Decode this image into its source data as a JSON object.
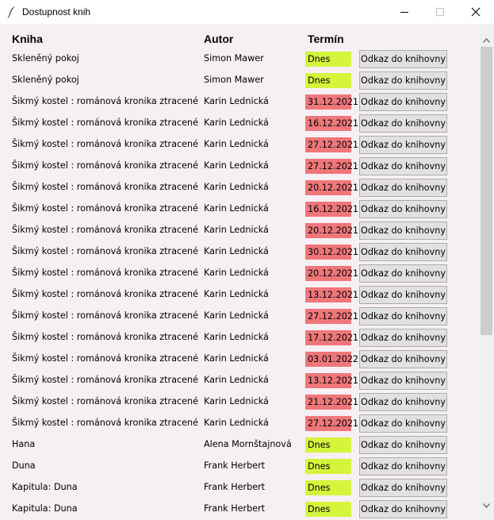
{
  "window": {
    "title": "Dostupnost knih",
    "icon": "feather-icon",
    "controls": [
      "minimize-icon",
      "maximize-icon",
      "close-icon"
    ]
  },
  "colors": {
    "today": "#d4f53c",
    "later": "#ef7779",
    "background": "#f6eff3"
  },
  "table": {
    "headers": {
      "title": "Kniha",
      "author": "Autor",
      "term": "Termín"
    },
    "button_label": "Odkaz do knihovny",
    "rows": [
      {
        "title": "Skleněný pokoj",
        "author": "Simon Mawer",
        "term": "Dnes",
        "status": "today"
      },
      {
        "title": "Skleněný pokoj",
        "author": "Simon Mawer",
        "term": "Dnes",
        "status": "today"
      },
      {
        "title": "Šikmý kostel : románová kronika ztracené",
        "author": "Karin Lednická",
        "term": "31.12.2021",
        "status": "later"
      },
      {
        "title": "Šikmý kostel : románová kronika ztracené",
        "author": "Karin Lednická",
        "term": "16.12.2021",
        "status": "later"
      },
      {
        "title": "Šikmý kostel : románová kronika ztracené",
        "author": "Karin Lednická",
        "term": "27.12.2021",
        "status": "later"
      },
      {
        "title": "Šikmý kostel : románová kronika ztracené",
        "author": "Karin Lednická",
        "term": "27.12.2021",
        "status": "later"
      },
      {
        "title": "Šikmý kostel : románová kronika ztracené",
        "author": "Karin Lednická",
        "term": "20.12.2021",
        "status": "later"
      },
      {
        "title": "Šikmý kostel : románová kronika ztracené",
        "author": "Karin Lednická",
        "term": "16.12.2021",
        "status": "later"
      },
      {
        "title": "Šikmý kostel : románová kronika ztracené",
        "author": "Karin Lednická",
        "term": "20.12.2021",
        "status": "later"
      },
      {
        "title": "Šikmý kostel : románová kronika ztracené",
        "author": "Karin Lednická",
        "term": "30.12.2021",
        "status": "later"
      },
      {
        "title": "Šikmý kostel : románová kronika ztracené",
        "author": "Karin Lednická",
        "term": "20.12.2021",
        "status": "later"
      },
      {
        "title": "Šikmý kostel : románová kronika ztracené",
        "author": "Karin Lednická",
        "term": "13.12.2021",
        "status": "later"
      },
      {
        "title": "Šikmý kostel : románová kronika ztracené",
        "author": "Karin Lednická",
        "term": "27.12.2021",
        "status": "later"
      },
      {
        "title": "Šikmý kostel : románová kronika ztracené",
        "author": "Karin Lednická",
        "term": "17.12.2021",
        "status": "later"
      },
      {
        "title": "Šikmý kostel : románová kronika ztracené",
        "author": "Karin Lednická",
        "term": "03.01.2022",
        "status": "later"
      },
      {
        "title": "Šikmý kostel : románová kronika ztracené",
        "author": "Karin Lednická",
        "term": "13.12.2021",
        "status": "later"
      },
      {
        "title": "Šikmý kostel : románová kronika ztracené",
        "author": "Karin Lednická",
        "term": "21.12.2021",
        "status": "later"
      },
      {
        "title": "Šikmý kostel : románová kronika ztracené",
        "author": "Karin Lednická",
        "term": "27.12.2021",
        "status": "later"
      },
      {
        "title": "Hana",
        "author": "Alena Mornštajnová",
        "term": "Dnes",
        "status": "today"
      },
      {
        "title": "Duna",
        "author": "Frank Herbert",
        "term": "Dnes",
        "status": "today"
      },
      {
        "title": "Kapitula: Duna",
        "author": "Frank Herbert",
        "term": "Dnes",
        "status": "today"
      },
      {
        "title": "Kapitula: Duna",
        "author": "Frank Herbert",
        "term": "Dnes",
        "status": "today"
      }
    ]
  },
  "scrollbar": {
    "up_icon": "scroll-up-arrow-icon",
    "down_icon": "scroll-down-arrow-icon"
  }
}
